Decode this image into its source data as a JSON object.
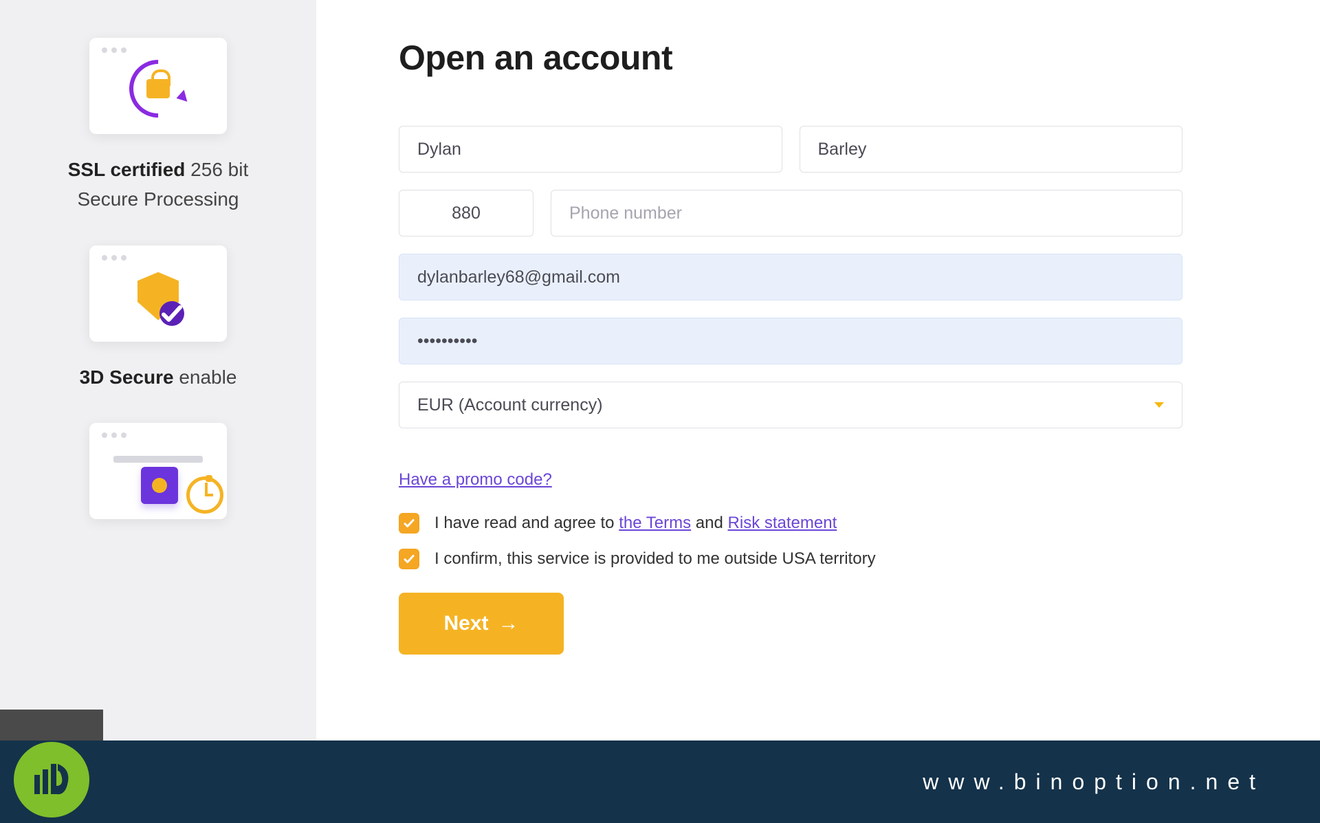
{
  "sidebar": {
    "features": [
      {
        "bold": "SSL certified",
        "rest": " 256 bit",
        "line2": "Secure Processing"
      },
      {
        "bold": "3D Secure",
        "rest": " enable",
        "line2": ""
      }
    ]
  },
  "form": {
    "title": "Open an account",
    "first_name": "Dylan",
    "last_name": "Barley",
    "country_code": "880",
    "phone_placeholder": "Phone number",
    "email": "dylanbarley68@gmail.com",
    "password_mask": "••••••••••",
    "currency": "EUR (Account currency)",
    "promo": "Have a promo code?",
    "terms_prefix": "I have read and agree to ",
    "terms_link": "the Terms",
    "terms_and": " and ",
    "risk_link": "Risk statement",
    "usa_confirm": "I confirm, this service is provided to me outside USA territory",
    "next": "Next"
  },
  "footer": {
    "url": "www.binoption.net"
  }
}
